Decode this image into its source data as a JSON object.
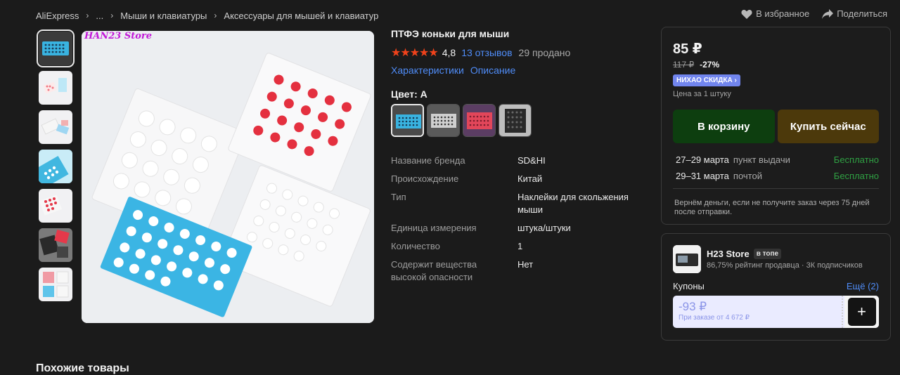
{
  "breadcrumb": {
    "items": [
      "AliExpress",
      "...",
      "Мыши и клавиатуры",
      "Аксессуары для мышей и клавиатур"
    ]
  },
  "top_actions": {
    "favorite": "В избранное",
    "share": "Поделиться"
  },
  "gallery": {
    "store_watermark": "HAN23 Store",
    "thumbnails": [
      "blue-sheet",
      "pink-sheets",
      "white-sheets",
      "blue-sheet-closeup",
      "red-sheet",
      "dark-sheets",
      "mixed-sheets"
    ]
  },
  "product": {
    "title": "ПТФЭ коньки для мыши",
    "stars": "★★★★★",
    "rating": "4,8",
    "reviews": "13 отзывов",
    "sold": "29 продано",
    "link_specs": "Характеристики",
    "link_desc": "Описание",
    "color_label": "Цвет: A",
    "variants": [
      "A-blue",
      "B-white",
      "C-red",
      "D-black"
    ]
  },
  "specs": [
    {
      "key": "Название бренда",
      "value": "SD&HI"
    },
    {
      "key": "Происхождение",
      "value": "Китай"
    },
    {
      "key": "Тип",
      "value": "Наклейки для скольжения мыши"
    },
    {
      "key": "Единица измерения",
      "value": "штука/штуки"
    },
    {
      "key": "Количество",
      "value": "1"
    },
    {
      "key": "Содержит вещества высокой опасности",
      "value": "Нет"
    }
  ],
  "buybox": {
    "price": "85 ₽",
    "old_price": "117 ₽",
    "discount": "-27%",
    "promo": "НИХАО СКИДКА ›",
    "per_unit": "Цена за 1 штуку",
    "cart": "В корзину",
    "buy": "Купить сейчас",
    "delivery": [
      {
        "date": "27–29 марта",
        "method": "пункт выдачи",
        "price": "Бесплатно"
      },
      {
        "date": "29–31 марта",
        "method": "почтой",
        "price": "Бесплатно"
      }
    ],
    "refund": "Вернём деньги, если не получите заказ через 75 дней после отправки."
  },
  "store": {
    "name": "H23 Store",
    "badge": "в топе",
    "meta": "86,75% рейтинг продавца · 3К подписчиков",
    "coupons_title": "Купоны",
    "coupons_more": "Ещё (2)",
    "coupon_value": "-93 ₽",
    "coupon_cond": "При заказе от 4 672 ₽",
    "plus": "+"
  },
  "similar_title": "Похожие товары",
  "colors": {
    "accent_blue": "#4f8cf7",
    "star_red": "#f0421b",
    "free_green": "#2fa043",
    "cart_btn": "#0d3e0f",
    "buy_btn": "#4c390b"
  }
}
